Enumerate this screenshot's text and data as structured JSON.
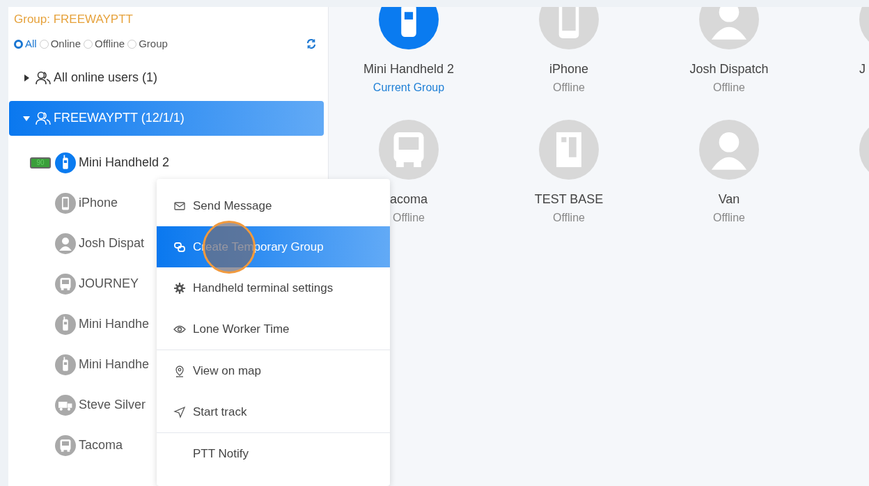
{
  "group_title": "Group: FREEWAYPTT",
  "filters": [
    {
      "label": "All",
      "selected": true
    },
    {
      "label": "Online",
      "selected": false
    },
    {
      "label": "Offline",
      "selected": false
    },
    {
      "label": "Group",
      "selected": false
    }
  ],
  "tree": [
    {
      "label": "All online users (1)",
      "expanded": false,
      "selected": false
    },
    {
      "label": "FREEWAYPTT (12/1/1)",
      "expanded": true,
      "selected": true,
      "children": [
        {
          "name": "Mini Handheld 2",
          "kind": "radio",
          "online": true,
          "battery": "90"
        },
        {
          "name": "iPhone",
          "kind": "phone",
          "online": false
        },
        {
          "name": "Josh Dispat",
          "kind": "person",
          "online": false
        },
        {
          "name": "JOURNEY",
          "kind": "bus",
          "online": false
        },
        {
          "name": "Mini Handhe",
          "kind": "radio",
          "online": false
        },
        {
          "name": "Mini Handhe",
          "kind": "radio",
          "online": false
        },
        {
          "name": "Steve Silver",
          "kind": "truck",
          "online": false
        },
        {
          "name": "Tacoma",
          "kind": "bus",
          "online": false
        }
      ]
    }
  ],
  "context_menu": [
    {
      "label": "Send Message",
      "selected": false,
      "clicked": false
    },
    {
      "label": "Create Temporary Group",
      "selected": true,
      "clicked": true
    },
    {
      "label": "Handheld terminal settings",
      "selected": false,
      "clicked": false
    },
    {
      "label": "Lone Worker Time",
      "selected": false,
      "clicked": false,
      "divider_after": true
    },
    {
      "label": "View on map",
      "selected": false,
      "clicked": false
    },
    {
      "label": "Start track",
      "selected": false,
      "clicked": false,
      "divider_after": true
    },
    {
      "label": "PTT Notify",
      "selected": false,
      "clicked": false
    }
  ],
  "members": [
    {
      "name": "Mini Handheld 2",
      "status": "Current Group",
      "kind": "radio",
      "online": true
    },
    {
      "name": "iPhone",
      "status": "Offline",
      "kind": "phone",
      "online": false
    },
    {
      "name": "Josh Dispatch",
      "status": "Offline",
      "kind": "person",
      "online": false
    },
    {
      "name": "J",
      "kind": "blank",
      "online": false,
      "clipped": true
    },
    {
      "name": "acoma",
      "status": "Offline",
      "kind": "bus",
      "online": false
    },
    {
      "name": "TEST BASE",
      "status": "Offline",
      "kind": "cabinet",
      "online": false
    },
    {
      "name": "Van",
      "status": "Offline",
      "kind": "person",
      "online": false
    },
    {
      "kind": "blank",
      "online": false
    }
  ]
}
